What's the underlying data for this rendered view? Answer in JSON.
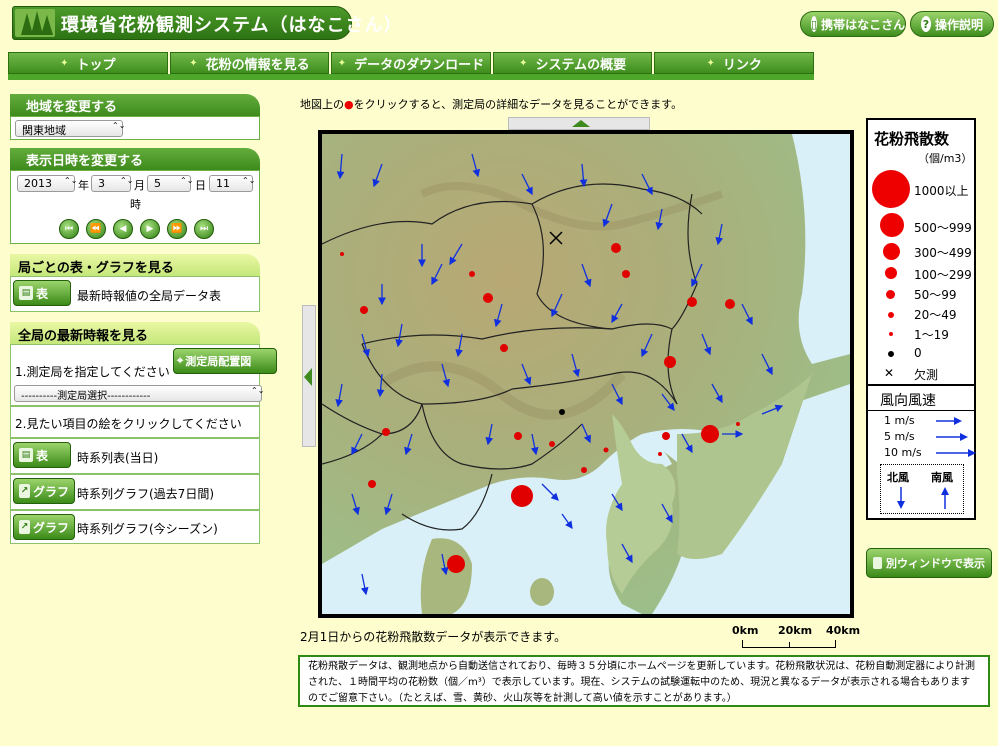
{
  "header": {
    "title": "環境省花粉観測システム（はなこさん）",
    "mobile_label": "携帯はなこさん",
    "help_label": "操作説明"
  },
  "nav": {
    "tabs": [
      {
        "label": "トップ"
      },
      {
        "label": "花粉の情報を見る"
      },
      {
        "label": "データのダウンロード"
      },
      {
        "label": "システムの概要"
      },
      {
        "label": "リンク"
      }
    ]
  },
  "region": {
    "title": "地域を変更する",
    "selected": "関東地域"
  },
  "datetime": {
    "title": "表示日時を変更する",
    "year": "2013",
    "year_unit": "年",
    "month": "3",
    "month_unit": "月",
    "day": "5",
    "day_unit": "日",
    "hour": "11",
    "hour_unit": "時"
  },
  "station_table": {
    "title": "局ごとの表・グラフを見る",
    "btn": "表",
    "text": "最新時報値の全局データ表"
  },
  "latest": {
    "title": "全局の最新時報を見る",
    "step1": "1.測定局を指定してください",
    "station_map_btn": "測定局配置図",
    "station_select": "----------測定局選択------------",
    "step2": "2.見たい項目の絵をクリックしてください",
    "rows": [
      {
        "btn": "表",
        "text": "時系列表(当日)"
      },
      {
        "btn": "グラフ",
        "text": "時系列グラフ(過去7日間)"
      },
      {
        "btn": "グラフ",
        "text": "時系列グラフ(今シーズン)"
      }
    ]
  },
  "map": {
    "instruction_pre": "地図上の",
    "instruction_dot": "●",
    "instruction_post": "をクリックすると、測定局の詳細なデータを見ることができます。",
    "from_note": "2月1日からの花粉飛散数データが表示できます。",
    "scale": [
      "0km",
      "20km",
      "40km"
    ]
  },
  "legend": {
    "title": "花粉飛散数",
    "unit": "（個/m3）",
    "items": [
      "1000以上",
      "500〜999",
      "300〜499",
      "100〜299",
      "50〜99",
      "20〜49",
      "1〜19",
      "0",
      "欠測"
    ],
    "missing_mark": "✕",
    "dot_color": "#e00000"
  },
  "wind": {
    "title": "風向風速",
    "items": [
      "1 m/s",
      "5 m/s",
      "10 m/s"
    ],
    "north": "北風",
    "south": "南風",
    "arrow_color": "#1030e0"
  },
  "popup_btn": "別ウィンドウで表示",
  "footer": "花粉飛散データは、観測地点から自動送信されており、毎時３５分頃にホームページを更新しています。花粉飛散状況は、花粉自動測定器により計測された、１時間平均の花粉数（個／m³）で表示しています。現在、システムの試験運転中のため、現況と異なるデータが表示される場合もありますのでご留意下さい。（たとえば、雪、黄砂、火山灰等を計測して高い値を示すことがあります。）"
}
